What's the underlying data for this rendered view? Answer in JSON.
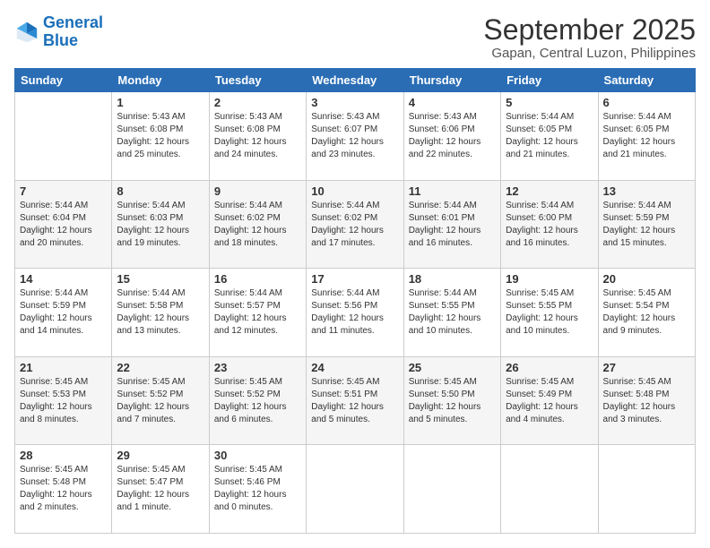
{
  "logo": {
    "line1": "General",
    "line2": "Blue"
  },
  "title": "September 2025",
  "subtitle": "Gapan, Central Luzon, Philippines",
  "weekdays": [
    "Sunday",
    "Monday",
    "Tuesday",
    "Wednesday",
    "Thursday",
    "Friday",
    "Saturday"
  ],
  "weeks": [
    [
      {
        "day": "",
        "text": ""
      },
      {
        "day": "1",
        "text": "Sunrise: 5:43 AM\nSunset: 6:08 PM\nDaylight: 12 hours\nand 25 minutes."
      },
      {
        "day": "2",
        "text": "Sunrise: 5:43 AM\nSunset: 6:08 PM\nDaylight: 12 hours\nand 24 minutes."
      },
      {
        "day": "3",
        "text": "Sunrise: 5:43 AM\nSunset: 6:07 PM\nDaylight: 12 hours\nand 23 minutes."
      },
      {
        "day": "4",
        "text": "Sunrise: 5:43 AM\nSunset: 6:06 PM\nDaylight: 12 hours\nand 22 minutes."
      },
      {
        "day": "5",
        "text": "Sunrise: 5:44 AM\nSunset: 6:05 PM\nDaylight: 12 hours\nand 21 minutes."
      },
      {
        "day": "6",
        "text": "Sunrise: 5:44 AM\nSunset: 6:05 PM\nDaylight: 12 hours\nand 21 minutes."
      }
    ],
    [
      {
        "day": "7",
        "text": "Sunrise: 5:44 AM\nSunset: 6:04 PM\nDaylight: 12 hours\nand 20 minutes."
      },
      {
        "day": "8",
        "text": "Sunrise: 5:44 AM\nSunset: 6:03 PM\nDaylight: 12 hours\nand 19 minutes."
      },
      {
        "day": "9",
        "text": "Sunrise: 5:44 AM\nSunset: 6:02 PM\nDaylight: 12 hours\nand 18 minutes."
      },
      {
        "day": "10",
        "text": "Sunrise: 5:44 AM\nSunset: 6:02 PM\nDaylight: 12 hours\nand 17 minutes."
      },
      {
        "day": "11",
        "text": "Sunrise: 5:44 AM\nSunset: 6:01 PM\nDaylight: 12 hours\nand 16 minutes."
      },
      {
        "day": "12",
        "text": "Sunrise: 5:44 AM\nSunset: 6:00 PM\nDaylight: 12 hours\nand 16 minutes."
      },
      {
        "day": "13",
        "text": "Sunrise: 5:44 AM\nSunset: 5:59 PM\nDaylight: 12 hours\nand 15 minutes."
      }
    ],
    [
      {
        "day": "14",
        "text": "Sunrise: 5:44 AM\nSunset: 5:59 PM\nDaylight: 12 hours\nand 14 minutes."
      },
      {
        "day": "15",
        "text": "Sunrise: 5:44 AM\nSunset: 5:58 PM\nDaylight: 12 hours\nand 13 minutes."
      },
      {
        "day": "16",
        "text": "Sunrise: 5:44 AM\nSunset: 5:57 PM\nDaylight: 12 hours\nand 12 minutes."
      },
      {
        "day": "17",
        "text": "Sunrise: 5:44 AM\nSunset: 5:56 PM\nDaylight: 12 hours\nand 11 minutes."
      },
      {
        "day": "18",
        "text": "Sunrise: 5:44 AM\nSunset: 5:55 PM\nDaylight: 12 hours\nand 10 minutes."
      },
      {
        "day": "19",
        "text": "Sunrise: 5:45 AM\nSunset: 5:55 PM\nDaylight: 12 hours\nand 10 minutes."
      },
      {
        "day": "20",
        "text": "Sunrise: 5:45 AM\nSunset: 5:54 PM\nDaylight: 12 hours\nand 9 minutes."
      }
    ],
    [
      {
        "day": "21",
        "text": "Sunrise: 5:45 AM\nSunset: 5:53 PM\nDaylight: 12 hours\nand 8 minutes."
      },
      {
        "day": "22",
        "text": "Sunrise: 5:45 AM\nSunset: 5:52 PM\nDaylight: 12 hours\nand 7 minutes."
      },
      {
        "day": "23",
        "text": "Sunrise: 5:45 AM\nSunset: 5:52 PM\nDaylight: 12 hours\nand 6 minutes."
      },
      {
        "day": "24",
        "text": "Sunrise: 5:45 AM\nSunset: 5:51 PM\nDaylight: 12 hours\nand 5 minutes."
      },
      {
        "day": "25",
        "text": "Sunrise: 5:45 AM\nSunset: 5:50 PM\nDaylight: 12 hours\nand 5 minutes."
      },
      {
        "day": "26",
        "text": "Sunrise: 5:45 AM\nSunset: 5:49 PM\nDaylight: 12 hours\nand 4 minutes."
      },
      {
        "day": "27",
        "text": "Sunrise: 5:45 AM\nSunset: 5:48 PM\nDaylight: 12 hours\nand 3 minutes."
      }
    ],
    [
      {
        "day": "28",
        "text": "Sunrise: 5:45 AM\nSunset: 5:48 PM\nDaylight: 12 hours\nand 2 minutes."
      },
      {
        "day": "29",
        "text": "Sunrise: 5:45 AM\nSunset: 5:47 PM\nDaylight: 12 hours\nand 1 minute."
      },
      {
        "day": "30",
        "text": "Sunrise: 5:45 AM\nSunset: 5:46 PM\nDaylight: 12 hours\nand 0 minutes."
      },
      {
        "day": "",
        "text": ""
      },
      {
        "day": "",
        "text": ""
      },
      {
        "day": "",
        "text": ""
      },
      {
        "day": "",
        "text": ""
      }
    ]
  ]
}
